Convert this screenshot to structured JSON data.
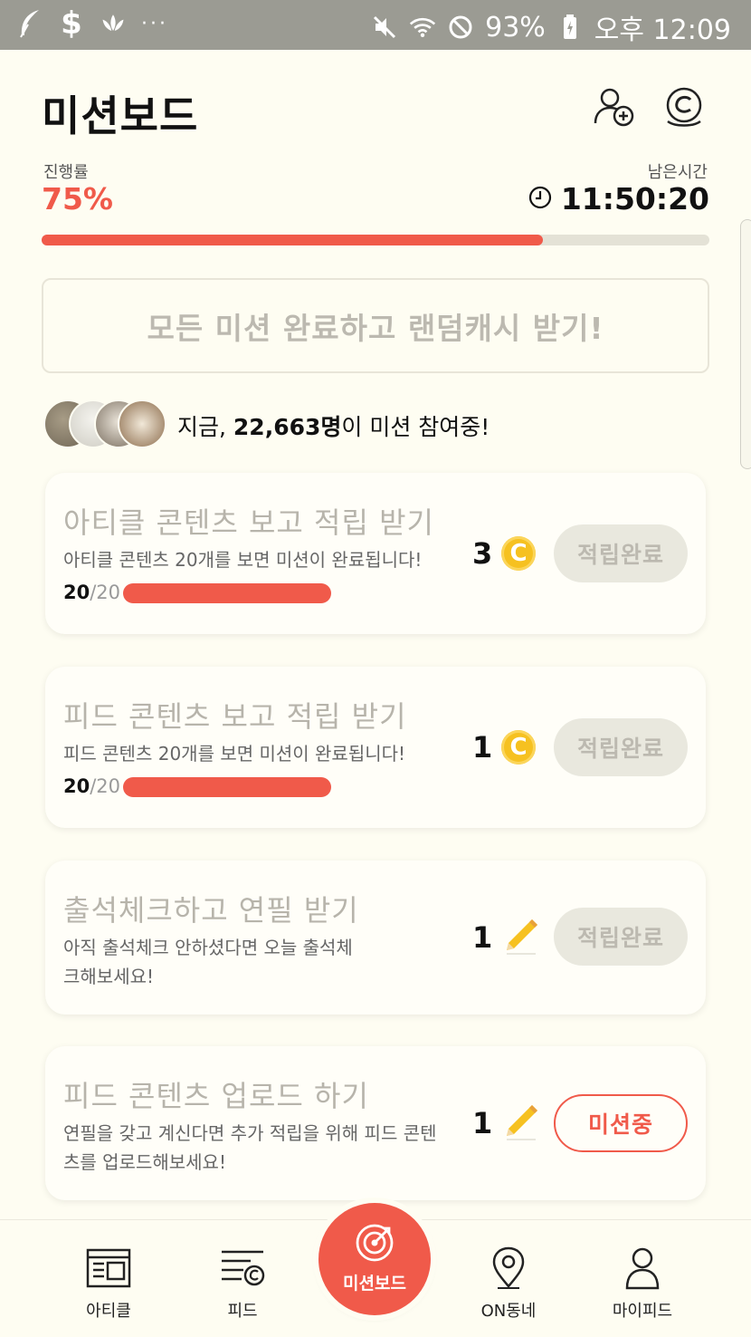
{
  "status_bar": {
    "battery": "93%",
    "time": "오후 12:09",
    "icons": [
      "feather-icon",
      "dollar-icon",
      "lotus-icon",
      "more-dots-icon",
      "mute-icon",
      "wifi-icon",
      "block-icon",
      "battery-icon"
    ]
  },
  "header": {
    "title": "미션보드",
    "add_friend_icon": "person-add-icon",
    "coin_icon": "coin-c-icon"
  },
  "progress": {
    "label": "진행률",
    "value": "75%",
    "fraction": 0.75,
    "remaining_label": "남은시간",
    "remaining_time": "11:50:20"
  },
  "banner": {
    "text": "모든 미션 완료하고 랜덤캐시 받기!"
  },
  "participants": {
    "prefix": "지금, ",
    "count": "22,663명",
    "suffix": "이 미션 참여중!"
  },
  "missions": [
    {
      "title": "아티클 콘텐츠 보고 적립 받기",
      "desc": "아티클 콘텐츠 20개를 보면 미션이 완료됩니다!",
      "count_done": "20",
      "count_total": "/20",
      "progress": 1.0,
      "reward": "3",
      "reward_icon": "coin-icon",
      "button": "적립완료"
    },
    {
      "title": "피드 콘텐츠 보고 적립 받기",
      "desc": "피드 콘텐츠 20개를 보면 미션이 완료됩니다!",
      "count_done": "20",
      "count_total": "/20",
      "progress": 1.0,
      "reward": "1",
      "reward_icon": "coin-icon",
      "button": "적립완료"
    },
    {
      "title": "출석체크하고 연필 받기",
      "desc": "아직 출석체크 안하셨다면 오늘 출석체크해보세요!",
      "reward": "1",
      "reward_icon": "pencil-icon",
      "button": "적립완료"
    },
    {
      "title": "피드 콘텐츠 업로드 하기",
      "desc": "연필을 갖고 계신다면 추가 적립을 위해 피드 콘텐츠를 업로드해보세요!",
      "reward": "1",
      "reward_icon": "pencil-icon",
      "button": "미션중"
    }
  ],
  "nav": {
    "article": "아티클",
    "feed": "피드",
    "missionboard": "미션보드",
    "neighborhood": "ON동네",
    "myfeed": "마이피드"
  },
  "colors": {
    "accent": "#f05a4a",
    "background": "#fefdf2",
    "coin": "#f6c120",
    "muted_text": "#b7b4ab"
  }
}
